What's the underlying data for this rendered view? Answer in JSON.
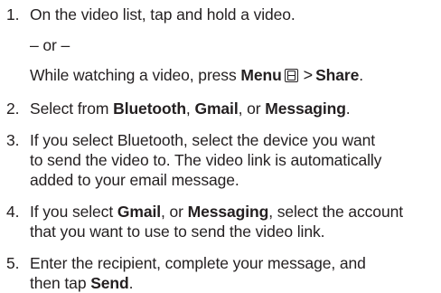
{
  "steps": [
    {
      "number": "1.",
      "text": "On the video list, tap and hold a video.",
      "or_text": "– or –",
      "alt_prefix": "While watching a video, press ",
      "menu_label": "Menu",
      "menu_icon": "menu-key-icon",
      "arrow": ">",
      "share_label": "Share",
      "alt_suffix": "."
    },
    {
      "number": "2.",
      "prefix": "Select from ",
      "opt1": "Bluetooth",
      "sep1": ", ",
      "opt2": "Gmail",
      "sep2": ", or ",
      "opt3": "Messaging",
      "suffix": "."
    },
    {
      "number": "3.",
      "lines": [
        "If you select Bluetooth, select the device you want",
        "to send the video to. The video link is automatically",
        "added to your email message."
      ]
    },
    {
      "number": "4.",
      "prefix": "If you select ",
      "opt1": "Gmail",
      "sep1": ", or ",
      "opt2": "Messaging",
      "mid": ", select the account",
      "line2": "that you want to use to send the video link."
    },
    {
      "number": "5.",
      "line1": "Enter the recipient, complete your message, and",
      "line2_prefix": "then tap ",
      "send_label": "Send",
      "line2_suffix": "."
    }
  ]
}
